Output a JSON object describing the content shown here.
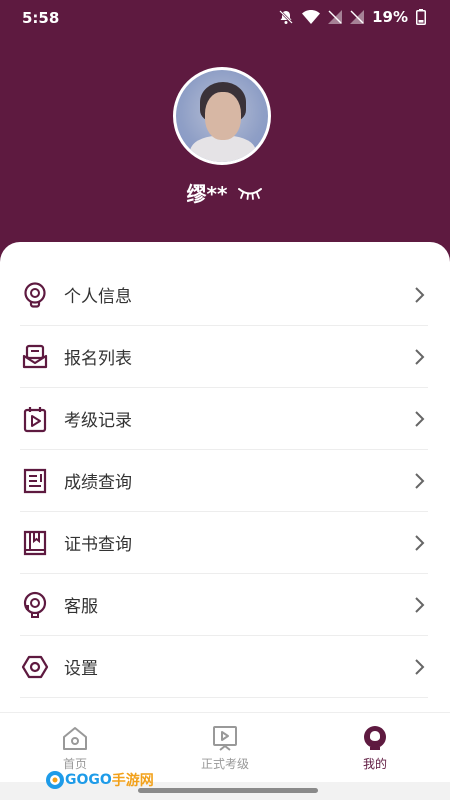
{
  "status_bar": {
    "time": "5:58",
    "battery": "19%"
  },
  "profile": {
    "username": "缪**"
  },
  "menu": {
    "items": [
      {
        "label": "个人信息",
        "icon": "lightbulb-icon"
      },
      {
        "label": "报名列表",
        "icon": "mailbox-icon"
      },
      {
        "label": "考级记录",
        "icon": "calendar-play-icon"
      },
      {
        "label": "成绩查询",
        "icon": "document-icon"
      },
      {
        "label": "证书查询",
        "icon": "book-icon"
      },
      {
        "label": "客服",
        "icon": "headset-icon"
      },
      {
        "label": "设置",
        "icon": "hexagon-settings-icon"
      }
    ]
  },
  "tabbar": {
    "home": "首页",
    "exam": "正式考级",
    "mine": "我的"
  },
  "watermark": {
    "text_a": "GOGO",
    "text_b": "手游网"
  },
  "colors": {
    "brand": "#5e1a40",
    "inactive": "#999999"
  }
}
